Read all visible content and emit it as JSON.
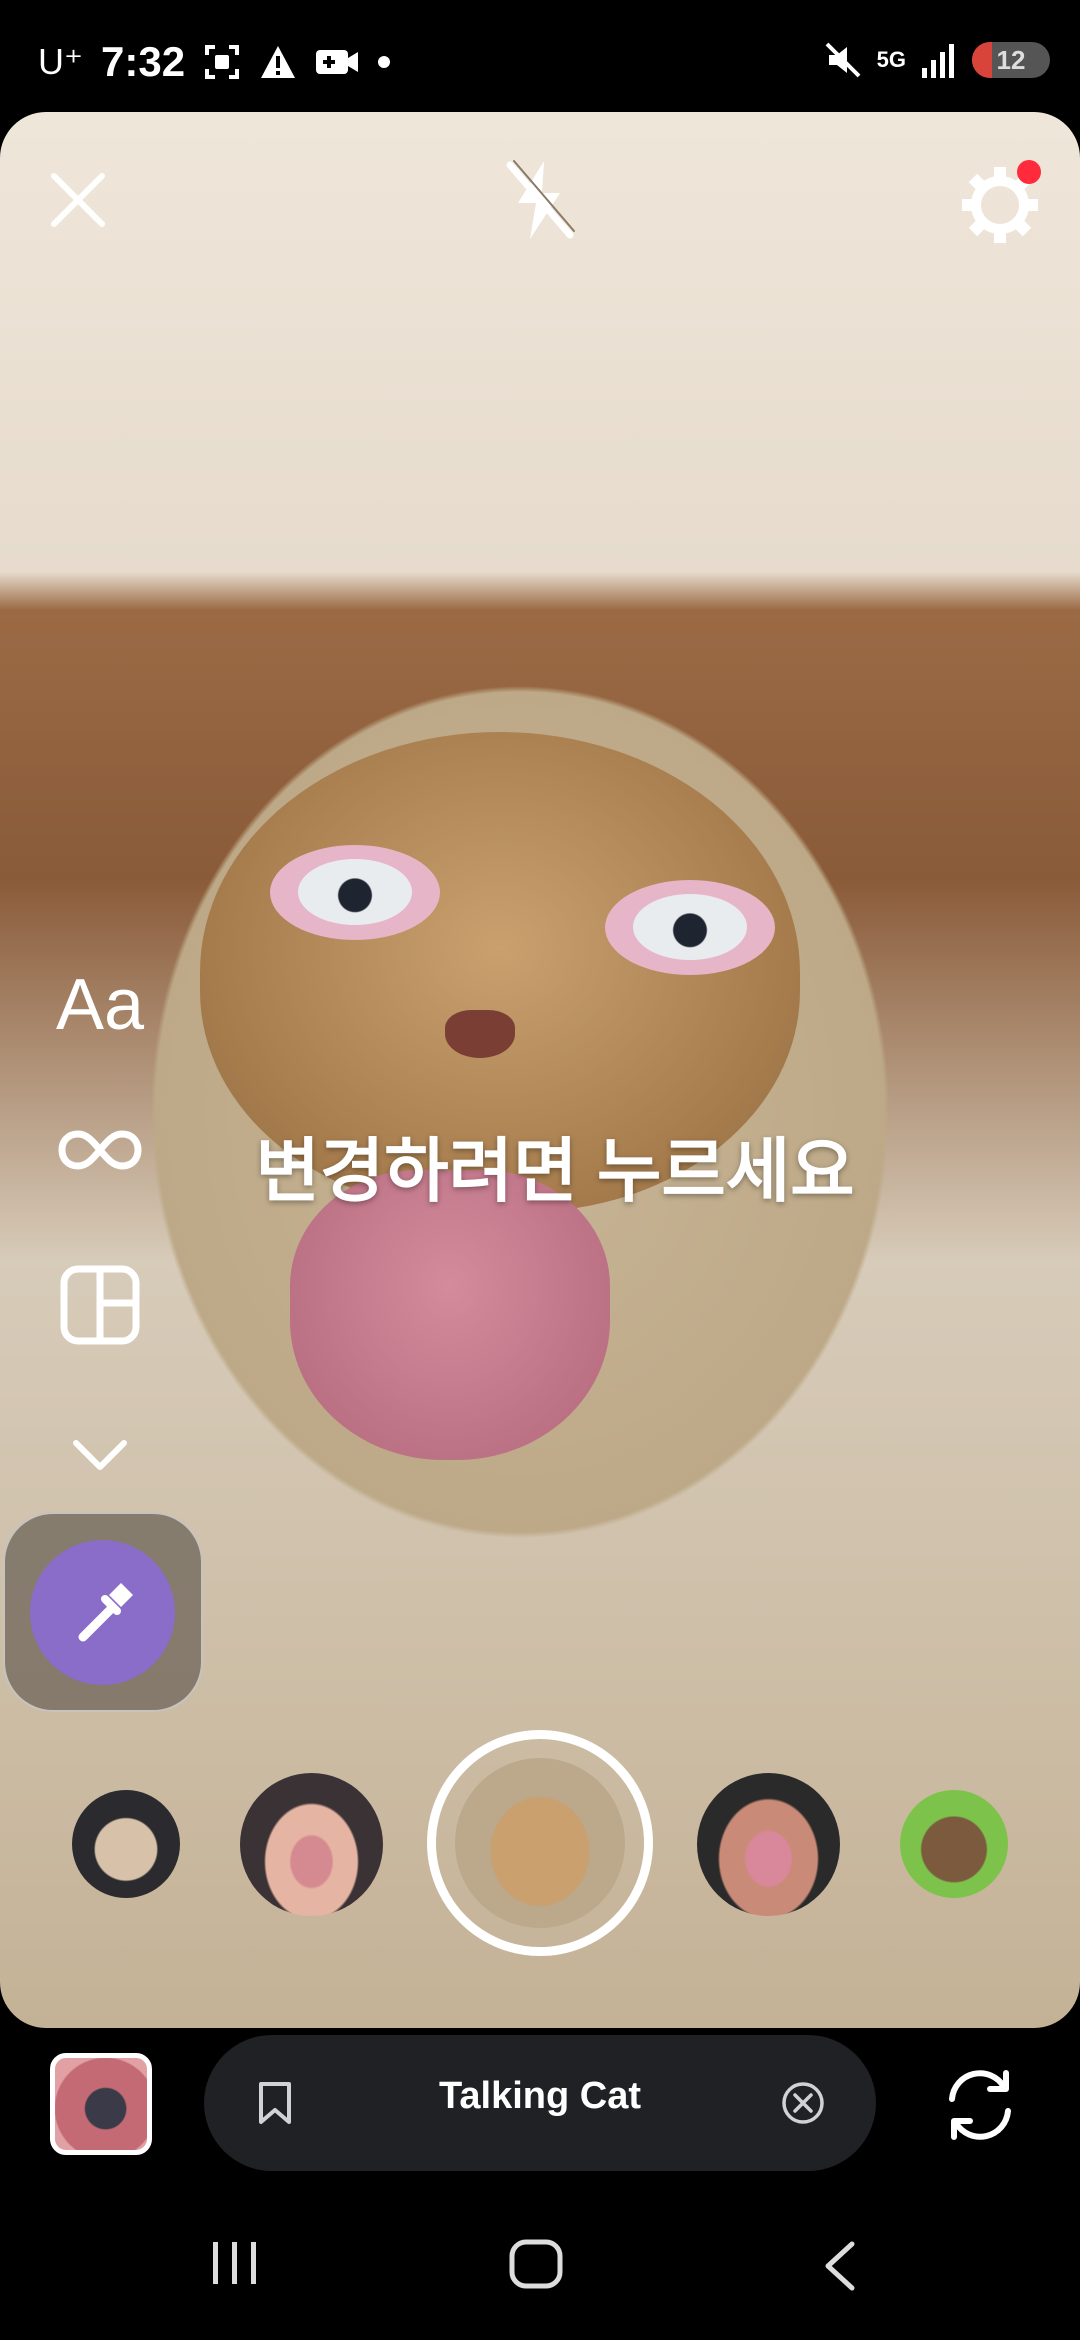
{
  "status_bar": {
    "carrier": "U⁺",
    "time": "7:32",
    "network": "5G",
    "battery": "12"
  },
  "camera": {
    "hint_text": "변경하려면 누르세요",
    "tools": {
      "text_label": "Aa"
    }
  },
  "effect_bar": {
    "title": "Talking Cat"
  },
  "colors": {
    "effect_button": "#8a6cc9",
    "pill_bg": "#1f2124",
    "notification_dot": "#ff2b3c"
  },
  "icons": [
    "close-icon",
    "flash-off-icon",
    "settings-gear-icon",
    "infinity-icon",
    "layout-icon",
    "chevron-down-icon",
    "eyedropper-icon",
    "bookmark-icon",
    "clear-icon",
    "camera-flip-icon",
    "recent-apps-icon",
    "home-icon",
    "back-icon"
  ]
}
